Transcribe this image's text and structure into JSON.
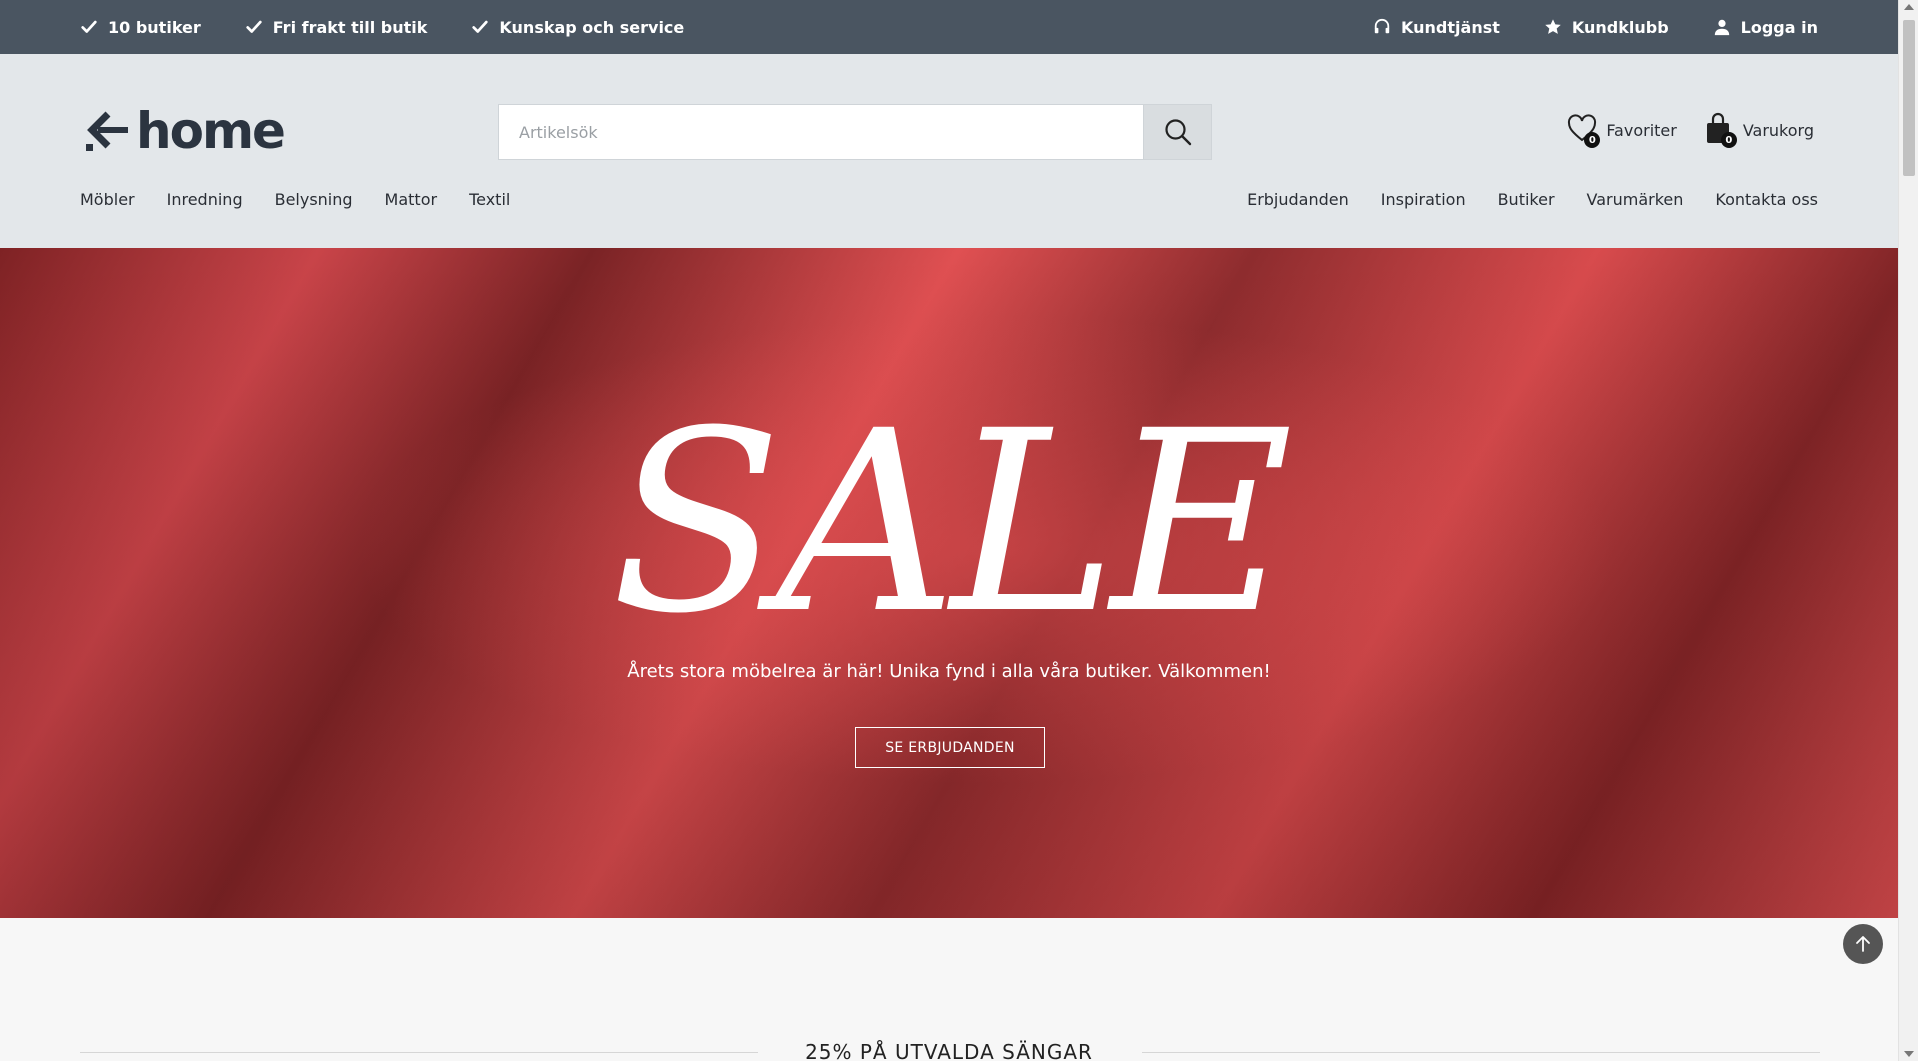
{
  "topbar": {
    "usps": [
      {
        "icon": "checkmark-icon",
        "label": "10 butiker"
      },
      {
        "icon": "checkmark-icon",
        "label": "Fri frakt till butik"
      },
      {
        "icon": "checkmark-icon",
        "label": "Kunskap och service"
      }
    ],
    "links": [
      {
        "icon": "headset-icon",
        "label": "Kundtjänst"
      },
      {
        "icon": "star-icon",
        "label": "Kundklubb"
      },
      {
        "icon": "user-icon",
        "label": "Logga in"
      }
    ]
  },
  "header": {
    "logo_text": "home",
    "search": {
      "placeholder": "Artikelsök",
      "value": ""
    },
    "favorites": {
      "label": "Favoriter",
      "count": "0"
    },
    "cart": {
      "label": "Varukorg",
      "count": "0"
    }
  },
  "nav": {
    "left": [
      "Möbler",
      "Inredning",
      "Belysning",
      "Mattor",
      "Textil"
    ],
    "right": [
      "Erbjudanden",
      "Inspiration",
      "Butiker",
      "Varumärken",
      "Kontakta oss"
    ]
  },
  "hero": {
    "headline": "SALE",
    "subtitle": "Årets stora möbelrea är här! Unika fynd i alla våra butiker. Välkommen!",
    "cta": "SE ERBJUDANDEN"
  },
  "section": {
    "title": "25% PÅ UTVALDA SÄNGAR"
  },
  "colors": {
    "topbar": "#4a5561",
    "header": "#e3e7ea",
    "hero_red": "#d94a4d"
  }
}
